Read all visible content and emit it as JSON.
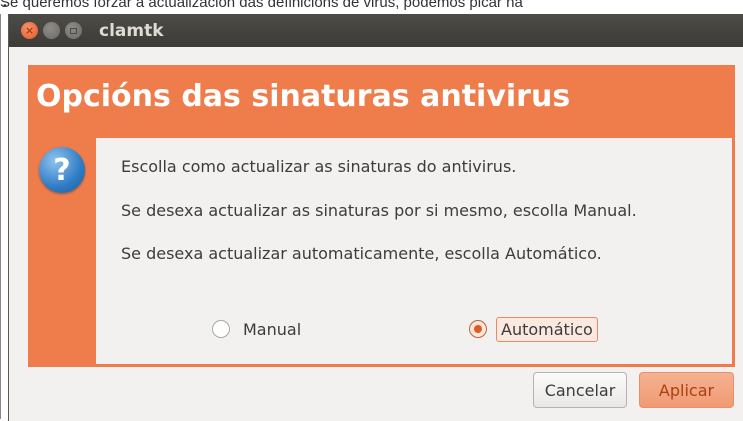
{
  "caption": {
    "text": "Se queremos forzar a actualización das definicións de virus, podemos picar na"
  },
  "window": {
    "title": "clamtk",
    "buttons": {
      "close_glyph": "×"
    }
  },
  "dialog": {
    "heading": "Opcións das sinaturas antivirus",
    "icon_glyph": "?",
    "messages": [
      "Escolla como actualizar as sinaturas do antivirus.",
      "Se desexa actualizar as sinaturas por si mesmo, escolla Manual.",
      "Se desexa actualizar automaticamente, escolla Automático."
    ],
    "options": [
      {
        "label": "Manual",
        "selected": false
      },
      {
        "label": "Automático",
        "selected": true
      }
    ],
    "cancel_label": "Cancelar",
    "apply_label": "Aplicar"
  },
  "colors": {
    "accent": "#ee7d4b",
    "titlebar": "#3c3b37",
    "background": "#f2f1f0",
    "info_icon": "#2f7cc4"
  },
  "icons": {
    "dialog": "question-icon",
    "close": "close-icon",
    "minimize": "minimize-icon",
    "maximize": "maximize-icon"
  }
}
